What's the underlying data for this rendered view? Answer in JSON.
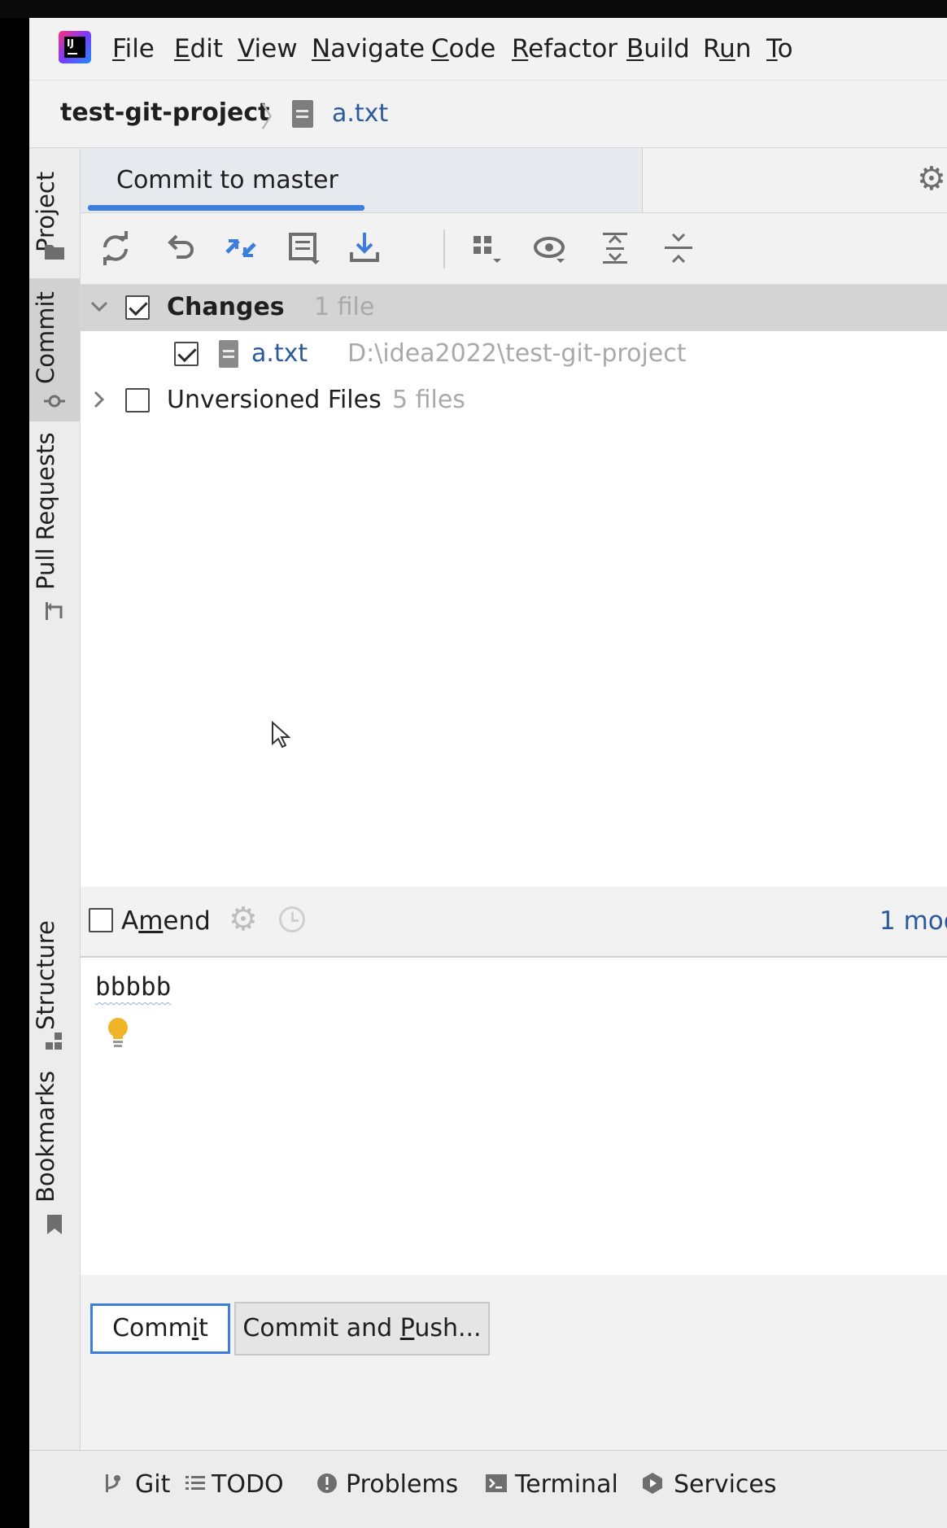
{
  "menu": {
    "items": [
      {
        "mnemonic": "F",
        "rest": "ile"
      },
      {
        "mnemonic": "E",
        "rest": "dit"
      },
      {
        "mnemonic": "V",
        "rest": "iew"
      },
      {
        "mnemonic": "N",
        "rest": "avigate"
      },
      {
        "mnemonic": "C",
        "rest": "ode"
      },
      {
        "mnemonic": "R",
        "rest": "efactor"
      },
      {
        "mnemonic": "B",
        "rest": "uild"
      },
      {
        "mnemonic": "R",
        "pre": "",
        "rest": "n",
        "full": "Run"
      },
      {
        "mnemonic": "T",
        "rest": "o"
      }
    ]
  },
  "breadcrumb": {
    "project": "test-git-project",
    "file": "a.txt"
  },
  "side_tools": {
    "project": "Project",
    "commit": "Commit",
    "pull_requests": "Pull Requests",
    "structure": "Structure",
    "bookmarks": "Bookmarks"
  },
  "commit_tab": {
    "title": "Commit to master"
  },
  "toolbar_icons": [
    "refresh-icon",
    "rollback-icon",
    "diff-icon",
    "shelve-icon",
    "update-icon",
    "group-by-icon",
    "view-options-icon",
    "expand-all-icon",
    "collapse-all-icon"
  ],
  "tree": {
    "changes": {
      "label": "Changes",
      "count": "1 file",
      "checked": true
    },
    "file": {
      "name": "a.txt",
      "path": "D:\\idea2022\\test-git-project",
      "checked": true
    },
    "unversioned": {
      "label": "Unversioned Files",
      "count": "5 files",
      "checked": false
    }
  },
  "amend": {
    "label_pre": "A",
    "label_mnemonic": "m",
    "label_post": "end",
    "checked": false,
    "modified_link": "1 mod"
  },
  "message": {
    "text": "bbbbb"
  },
  "buttons": {
    "commit_pre": "Comm",
    "commit_mnemonic": "i",
    "commit_post": "t",
    "commit_push_pre": "Commit and ",
    "commit_push_mnemonic": "P",
    "commit_push_post": "ush..."
  },
  "bottom_tools": {
    "git": "Git",
    "todo": "TODO",
    "problems": "Problems",
    "terminal": "Terminal",
    "services": "Services"
  },
  "colors": {
    "accent": "#3d7ddb",
    "link": "#2a5a9c",
    "selection": "#d4d4d4"
  }
}
